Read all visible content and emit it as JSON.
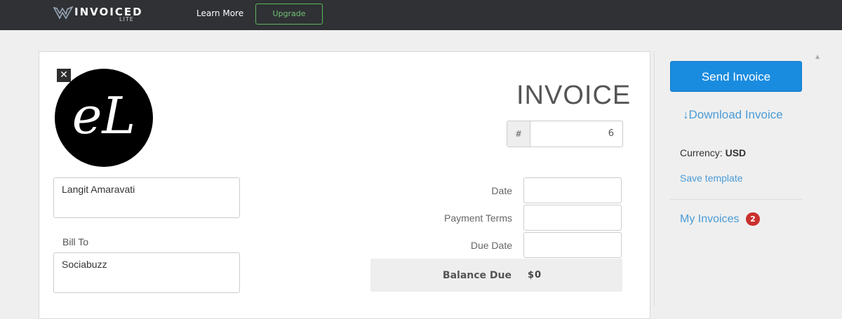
{
  "topbar": {
    "logo_text": "INVOICED",
    "logo_sub": "LITE",
    "learn_more": "Learn More",
    "upgrade": "Upgrade"
  },
  "invoice": {
    "remove_logo": "✕",
    "logo_letters": "eL",
    "title": "INVOICE",
    "number_prefix": "#",
    "number": "6",
    "from": "Langit Amaravati",
    "bill_to_label": "Bill To",
    "bill_to": "Sociabuzz",
    "date_label": "Date",
    "date_value": "",
    "payment_terms_label": "Payment Terms",
    "payment_terms_value": "",
    "due_date_label": "Due Date",
    "due_date_value": "",
    "balance_due_label": "Balance Due",
    "balance_due_value": "$0"
  },
  "sidebar": {
    "send_invoice": "Send Invoice",
    "download_invoice": "Download Invoice",
    "currency_label": "Currency:",
    "currency_value": "USD",
    "save_template": "Save template",
    "my_invoices": "My Invoices",
    "my_invoices_count": "2"
  },
  "colors": {
    "topbar": "#2f3135",
    "primary": "#1a8ce0",
    "link": "#4a9bd6",
    "upgrade_border": "#5cb85c",
    "badge": "#c9302c"
  }
}
